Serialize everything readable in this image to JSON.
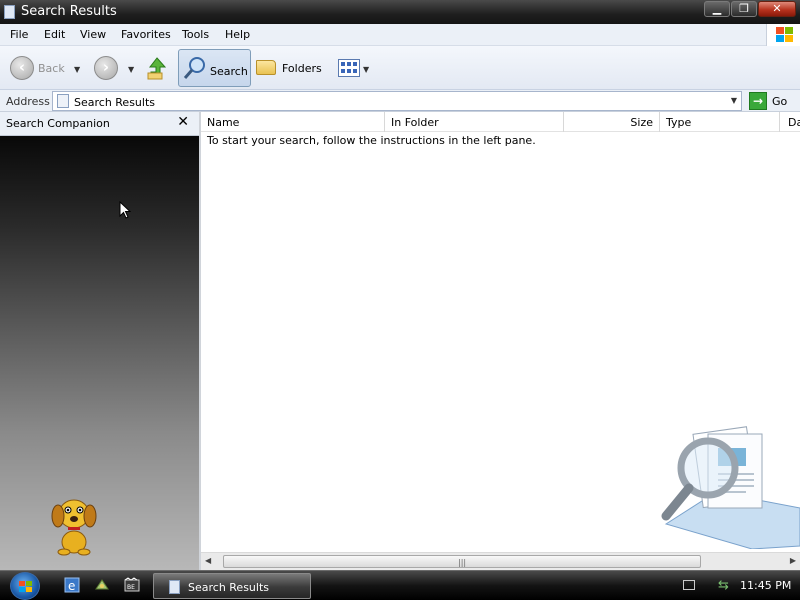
{
  "window": {
    "title": "Search Results"
  },
  "menu": {
    "items": [
      "File",
      "Edit",
      "View",
      "Favorites",
      "Tools",
      "Help"
    ]
  },
  "toolbar": {
    "back_label": "Back",
    "search_label": "Search",
    "folders_label": "Folders"
  },
  "address": {
    "label": "Address",
    "value": "Search Results",
    "go_label": "Go"
  },
  "left_pane": {
    "title": "Search Companion",
    "close_glyph": "✕"
  },
  "results": {
    "columns": [
      "Name",
      "In Folder",
      "Size",
      "Type",
      "Da"
    ],
    "instruction": "To start your search, follow the instructions in the left pane."
  },
  "taskbar": {
    "active_window": "Search Results",
    "clock": "11:45 PM"
  },
  "colors": {
    "accent": "#7f9db9",
    "chrome": "#ebf0f7",
    "go_green": "#3aa83a"
  }
}
